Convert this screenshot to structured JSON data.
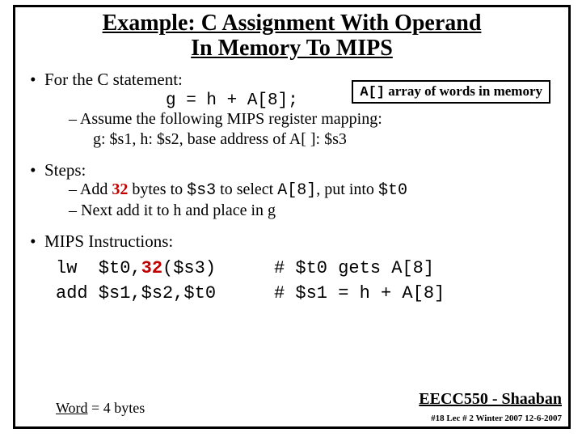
{
  "title_line1": "Example:  C Assignment With Operand",
  "title_line2": "In Memory To MIPS",
  "badge_code": "A[]",
  "badge_rest": " array of words in memory",
  "bullet1": "For the C statement:",
  "c_stmt": "g = h + A[8];",
  "assume": "Assume the following MIPS register mapping:",
  "mapping": "g: $s1,      h: $s2,      base address of A[ ]:  $s3",
  "steps_label": "Steps:",
  "step1_a": "Add ",
  "step1_red": "32",
  "step1_b": " bytes to ",
  "step1_c": "$s3",
  "step1_d": " to select ",
  "step1_e": "A[8]",
  "step1_f": ", put into ",
  "step1_g": "$t0",
  "step2": "Next add it to h and place in g",
  "mips_label": "MIPS Instructions:",
  "instr1_left_a": "lw  $t0,",
  "instr1_left_red": "32",
  "instr1_left_b": "($s3)",
  "instr1_right": "# $t0 gets A[8]",
  "instr2_left": "add $s1,$s2,$t0",
  "instr2_right": "# $s1 = h + A[8]",
  "word_a": "Word",
  "word_b": " = 4 bytes",
  "course": "EECC550 - Shaaban",
  "footer_small": "#18   Lec # 2  Winter 2007  12-6-2007"
}
